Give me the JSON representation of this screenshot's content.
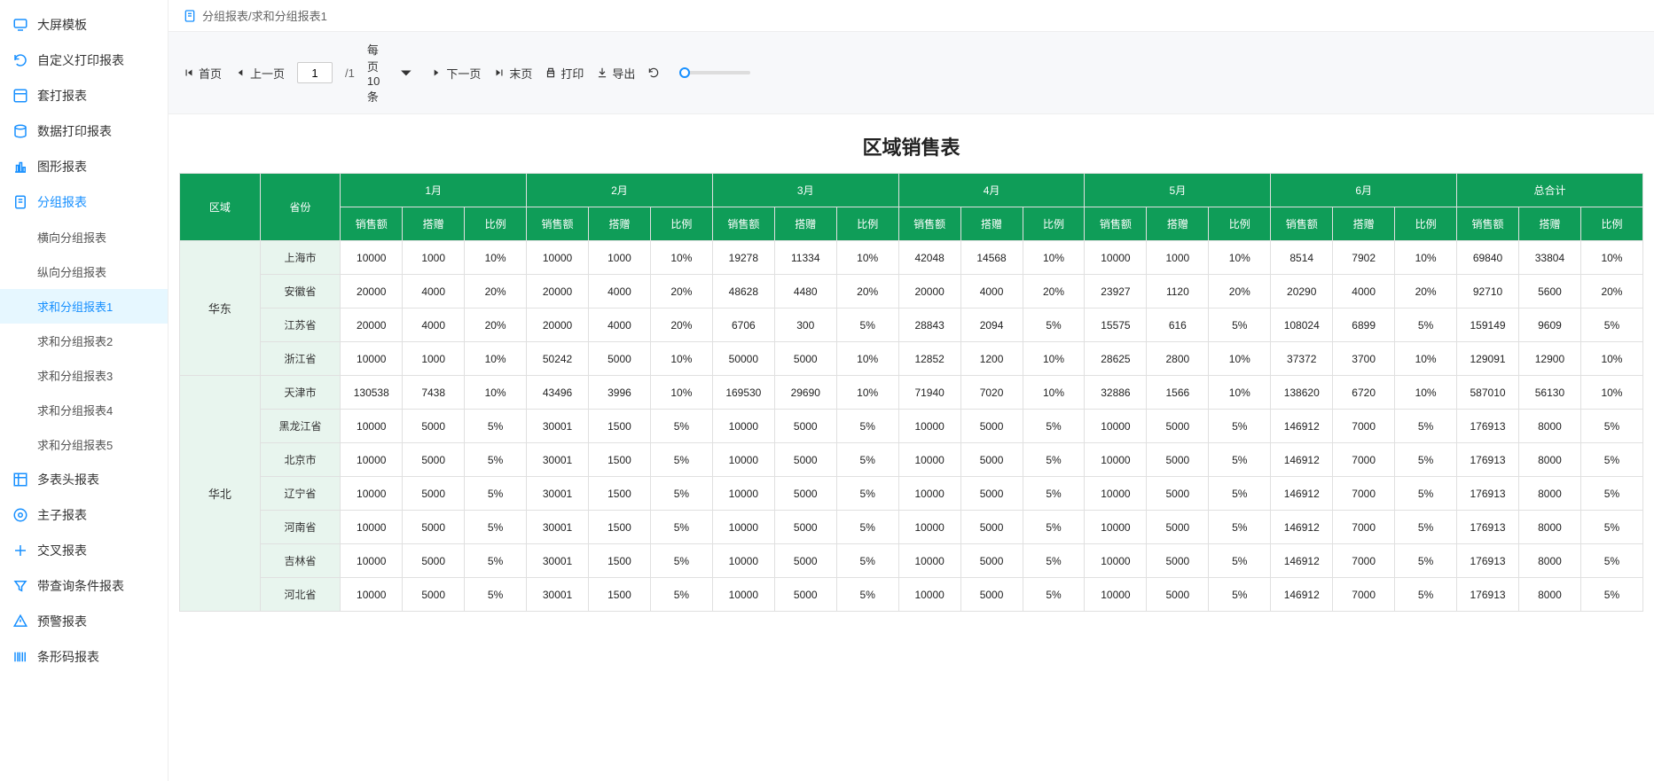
{
  "sidebar": {
    "items": [
      {
        "label": "大屏模板",
        "icon": "monitor"
      },
      {
        "label": "自定义打印报表",
        "icon": "refresh"
      },
      {
        "label": "套打报表",
        "icon": "layout"
      },
      {
        "label": "数据打印报表",
        "icon": "db"
      },
      {
        "label": "图形报表",
        "icon": "chart"
      },
      {
        "label": "分组报表",
        "icon": "doc",
        "open": true,
        "children": [
          {
            "label": "横向分组报表"
          },
          {
            "label": "纵向分组报表"
          },
          {
            "label": "求和分组报表1",
            "active": true
          },
          {
            "label": "求和分组报表2"
          },
          {
            "label": "求和分组报表3"
          },
          {
            "label": "求和分组报表4"
          },
          {
            "label": "求和分组报表5"
          }
        ]
      },
      {
        "label": "多表头报表",
        "icon": "table"
      },
      {
        "label": "主子报表",
        "icon": "subtable"
      },
      {
        "label": "交叉报表",
        "icon": "cross"
      },
      {
        "label": "带查询条件报表",
        "icon": "filter"
      },
      {
        "label": "预警报表",
        "icon": "alert"
      },
      {
        "label": "条形码报表",
        "icon": "barcode"
      }
    ]
  },
  "breadcrumb": "分组报表/求和分组报表1",
  "toolbar": {
    "first": "首页",
    "prev": "上一页",
    "page": "1",
    "total": "/1",
    "perPage": "每页10条",
    "next": "下一页",
    "last": "末页",
    "print": "打印",
    "export": "导出"
  },
  "report": {
    "title": "区域销售表",
    "cornerRegion": "区域",
    "cornerProvince": "省份",
    "months": [
      "1月",
      "2月",
      "3月",
      "4月",
      "5月",
      "6月",
      "总合计"
    ],
    "metrics": [
      "销售额",
      "搭赠",
      "比例"
    ],
    "groups": [
      {
        "region": "华东",
        "rows": [
          {
            "province": "上海市",
            "v": [
              [
                "10000",
                "1000",
                "10%"
              ],
              [
                "10000",
                "1000",
                "10%"
              ],
              [
                "19278",
                "11334",
                "10%"
              ],
              [
                "42048",
                "14568",
                "10%"
              ],
              [
                "10000",
                "1000",
                "10%"
              ],
              [
                "8514",
                "7902",
                "10%"
              ],
              [
                "69840",
                "33804",
                "10%"
              ]
            ]
          },
          {
            "province": "安徽省",
            "v": [
              [
                "20000",
                "4000",
                "20%"
              ],
              [
                "20000",
                "4000",
                "20%"
              ],
              [
                "48628",
                "4480",
                "20%"
              ],
              [
                "20000",
                "4000",
                "20%"
              ],
              [
                "23927",
                "1120",
                "20%"
              ],
              [
                "20290",
                "4000",
                "20%"
              ],
              [
                "92710",
                "5600",
                "20%"
              ]
            ]
          },
          {
            "province": "江苏省",
            "v": [
              [
                "20000",
                "4000",
                "20%"
              ],
              [
                "20000",
                "4000",
                "20%"
              ],
              [
                "6706",
                "300",
                "5%"
              ],
              [
                "28843",
                "2094",
                "5%"
              ],
              [
                "15575",
                "616",
                "5%"
              ],
              [
                "108024",
                "6899",
                "5%"
              ],
              [
                "159149",
                "9609",
                "5%"
              ]
            ]
          },
          {
            "province": "浙江省",
            "v": [
              [
                "10000",
                "1000",
                "10%"
              ],
              [
                "50242",
                "5000",
                "10%"
              ],
              [
                "50000",
                "5000",
                "10%"
              ],
              [
                "12852",
                "1200",
                "10%"
              ],
              [
                "28625",
                "2800",
                "10%"
              ],
              [
                "37372",
                "3700",
                "10%"
              ],
              [
                "129091",
                "12900",
                "10%"
              ]
            ]
          }
        ]
      },
      {
        "region": "华北",
        "rows": [
          {
            "province": "天津市",
            "v": [
              [
                "130538",
                "7438",
                "10%"
              ],
              [
                "43496",
                "3996",
                "10%"
              ],
              [
                "169530",
                "29690",
                "10%"
              ],
              [
                "71940",
                "7020",
                "10%"
              ],
              [
                "32886",
                "1566",
                "10%"
              ],
              [
                "138620",
                "6720",
                "10%"
              ],
              [
                "587010",
                "56130",
                "10%"
              ]
            ]
          },
          {
            "province": "黑龙江省",
            "v": [
              [
                "10000",
                "5000",
                "5%"
              ],
              [
                "30001",
                "1500",
                "5%"
              ],
              [
                "10000",
                "5000",
                "5%"
              ],
              [
                "10000",
                "5000",
                "5%"
              ],
              [
                "10000",
                "5000",
                "5%"
              ],
              [
                "146912",
                "7000",
                "5%"
              ],
              [
                "176913",
                "8000",
                "5%"
              ]
            ]
          },
          {
            "province": "北京市",
            "v": [
              [
                "10000",
                "5000",
                "5%"
              ],
              [
                "30001",
                "1500",
                "5%"
              ],
              [
                "10000",
                "5000",
                "5%"
              ],
              [
                "10000",
                "5000",
                "5%"
              ],
              [
                "10000",
                "5000",
                "5%"
              ],
              [
                "146912",
                "7000",
                "5%"
              ],
              [
                "176913",
                "8000",
                "5%"
              ]
            ]
          },
          {
            "province": "辽宁省",
            "v": [
              [
                "10000",
                "5000",
                "5%"
              ],
              [
                "30001",
                "1500",
                "5%"
              ],
              [
                "10000",
                "5000",
                "5%"
              ],
              [
                "10000",
                "5000",
                "5%"
              ],
              [
                "10000",
                "5000",
                "5%"
              ],
              [
                "146912",
                "7000",
                "5%"
              ],
              [
                "176913",
                "8000",
                "5%"
              ]
            ]
          },
          {
            "province": "河南省",
            "v": [
              [
                "10000",
                "5000",
                "5%"
              ],
              [
                "30001",
                "1500",
                "5%"
              ],
              [
                "10000",
                "5000",
                "5%"
              ],
              [
                "10000",
                "5000",
                "5%"
              ],
              [
                "10000",
                "5000",
                "5%"
              ],
              [
                "146912",
                "7000",
                "5%"
              ],
              [
                "176913",
                "8000",
                "5%"
              ]
            ]
          },
          {
            "province": "吉林省",
            "v": [
              [
                "10000",
                "5000",
                "5%"
              ],
              [
                "30001",
                "1500",
                "5%"
              ],
              [
                "10000",
                "5000",
                "5%"
              ],
              [
                "10000",
                "5000",
                "5%"
              ],
              [
                "10000",
                "5000",
                "5%"
              ],
              [
                "146912",
                "7000",
                "5%"
              ],
              [
                "176913",
                "8000",
                "5%"
              ]
            ]
          },
          {
            "province": "河北省",
            "v": [
              [
                "10000",
                "5000",
                "5%"
              ],
              [
                "30001",
                "1500",
                "5%"
              ],
              [
                "10000",
                "5000",
                "5%"
              ],
              [
                "10000",
                "5000",
                "5%"
              ],
              [
                "10000",
                "5000",
                "5%"
              ],
              [
                "146912",
                "7000",
                "5%"
              ],
              [
                "176913",
                "8000",
                "5%"
              ]
            ]
          }
        ]
      }
    ]
  }
}
